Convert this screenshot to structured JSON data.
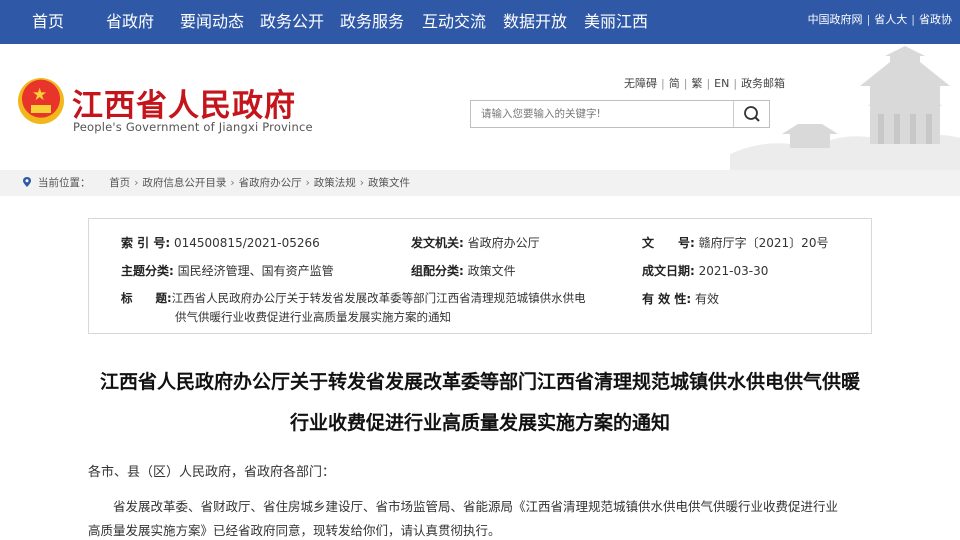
{
  "nav": {
    "items": [
      "首页",
      "省政府",
      "要闻动态",
      "政务公开",
      "政务服务",
      "互动交流",
      "数据开放",
      "美丽江西"
    ],
    "right_links": [
      "中国政府网",
      "省人大",
      "省政协"
    ]
  },
  "header": {
    "title": "江西省人民政府",
    "subtitle": "People's Government of Jiangxi Province",
    "util_links": [
      "无障碍",
      "简",
      "繁",
      "EN",
      "政务邮箱"
    ],
    "search_placeholder": "请输入您要输入的关键字!"
  },
  "breadcrumb": {
    "prefix": "当前位置：",
    "items": [
      "首页",
      "政府信息公开目录",
      "省政府办公厅",
      "政策法规",
      "政策文件"
    ]
  },
  "meta": {
    "index_label": "索 引 号:",
    "index_value": "014500815/2021-05266",
    "issuer_label": "发文机关:",
    "issuer_value": "省政府办公厅",
    "docno_label": "文　　号:",
    "docno_value": "赣府厅字〔2021〕20号",
    "topic_label": "主题分类:",
    "topic_value": "国民经济管理、国有资产监管",
    "category_label": "组配分类:",
    "category_value": "政策文件",
    "date_label": "成文日期:",
    "date_value": "2021-03-30",
    "subject_label": "标　　题:",
    "subject_line1": "江西省人民政府办公厅关于转发省发展改革委等部门江西省清理规范城镇供水供电",
    "subject_line2": "供气供暖行业收费促进行业高质量发展实施方案的通知",
    "validity_label": "有 效 性:",
    "validity_value": "有效"
  },
  "article": {
    "title_line1": "江西省人民政府办公厅关于转发省发展改革委等部门江西省清理规范城镇供水供电供气供暖",
    "title_line2": "行业收费促进行业高质量发展实施方案的通知",
    "salutation": "各市、县（区）人民政府，省政府各部门：",
    "body_line1": "省发展改革委、省财政厅、省住房城乡建设厅、省市场监管局、省能源局《江西省清理规范城镇供水供电供气供暖行业收费促进行业",
    "body_line2": "高质量发展实施方案》已经省政府同意，现转发给你们，请认真贯彻执行。"
  },
  "colors": {
    "nav_bg": "#2f58a6",
    "title_red": "#c3151b",
    "crumb_bg": "#f2f2f2"
  }
}
